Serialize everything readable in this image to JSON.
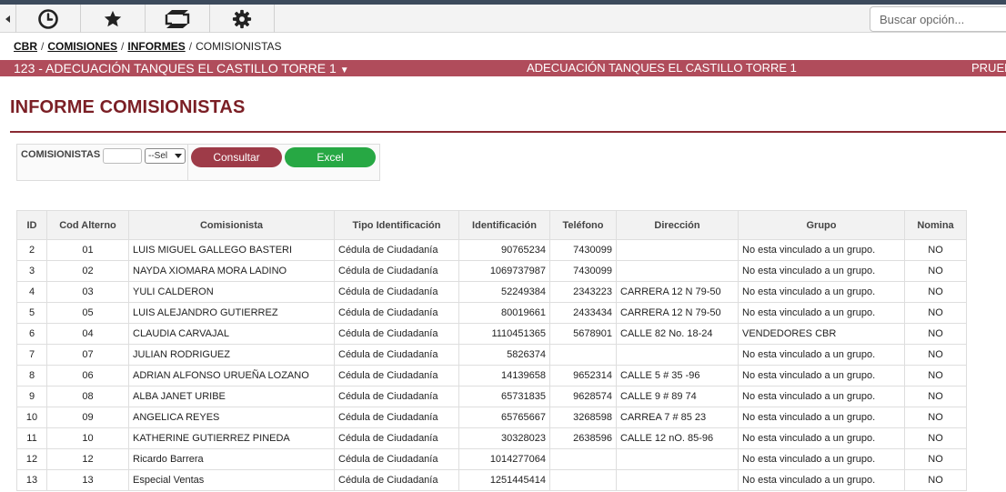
{
  "toolbar": {
    "icons": [
      "clock-icon",
      "star-icon",
      "exchange-icon",
      "gear-icon"
    ],
    "search_placeholder": "Buscar opción..."
  },
  "breadcrumb": {
    "items": [
      "CBR",
      "COMISIONES",
      "INFORMES"
    ],
    "current": "COMISIONISTAS"
  },
  "project_bar": {
    "selected": "123 - ADECUACIÓN TANQUES EL CASTILLO TORRE 1",
    "center_text": "ADECUACIÓN TANQUES EL CASTILLO TORRE 1",
    "right_text": "PRUEB",
    "color": "#b04c5b"
  },
  "page_title": "INFORME COMISIONISTAS",
  "filter": {
    "label": "COMISIONISTAS",
    "input_value": "",
    "select_value": "--Sel",
    "consultar_label": "Consultar",
    "excel_label": "Excel"
  },
  "table": {
    "headers": [
      "ID",
      "Cod Alterno",
      "Comisionista",
      "Tipo Identificación",
      "Identificación",
      "Teléfono",
      "Dirección",
      "Grupo",
      "Nomina"
    ],
    "rows": [
      [
        "2",
        "01",
        "LUIS MIGUEL GALLEGO BASTERI",
        "Cédula de Ciudadanía",
        "90765234",
        "7430099",
        "",
        "No esta vinculado a un grupo.",
        "NO"
      ],
      [
        "3",
        "02",
        "NAYDA XIOMARA MORA LADINO",
        "Cédula de Ciudadanía",
        "1069737987",
        "7430099",
        "",
        "No esta vinculado a un grupo.",
        "NO"
      ],
      [
        "4",
        "03",
        "YULI CALDERON",
        "Cédula de Ciudadanía",
        "52249384",
        "2343223",
        "CARRERA 12 N 79-50",
        "No esta vinculado a un grupo.",
        "NO"
      ],
      [
        "5",
        "05",
        "LUIS ALEJANDRO GUTIERREZ",
        "Cédula de Ciudadanía",
        "80019661",
        "2433434",
        "CARRERA 12 N 79-50",
        "No esta vinculado a un grupo.",
        "NO"
      ],
      [
        "6",
        "04",
        "CLAUDIA CARVAJAL",
        "Cédula de Ciudadanía",
        "1110451365",
        "5678901",
        "CALLE 82 No. 18-24",
        "VENDEDORES CBR",
        "NO"
      ],
      [
        "7",
        "07",
        "JULIAN RODRIGUEZ",
        "Cédula de Ciudadanía",
        "5826374",
        "",
        "",
        "No esta vinculado a un grupo.",
        "NO"
      ],
      [
        "8",
        "06",
        "ADRIAN ALFONSO URUEÑA LOZANO",
        "Cédula de Ciudadanía",
        "14139658",
        "9652314",
        "CALLE 5 # 35 -96",
        "No esta vinculado a un grupo.",
        "NO"
      ],
      [
        "9",
        "08",
        "ALBA JANET URIBE",
        "Cédula de Ciudadanía",
        "65731835",
        "9628574",
        "CALLE 9 # 89 74",
        "No esta vinculado a un grupo.",
        "NO"
      ],
      [
        "10",
        "09",
        "ANGELICA REYES",
        "Cédula de Ciudadanía",
        "65765667",
        "3268598",
        "CARREA 7 # 85 23",
        "No esta vinculado a un grupo.",
        "NO"
      ],
      [
        "11",
        "10",
        "KATHERINE GUTIERREZ PINEDA",
        "Cédula de Ciudadanía",
        "30328023",
        "2638596",
        "CALLE 12 nO. 85-96",
        "No esta vinculado a un grupo.",
        "NO"
      ],
      [
        "12",
        "12",
        "Ricardo Barrera",
        "Cédula de Ciudadanía",
        "1014277064",
        "",
        "",
        "No esta vinculado a un grupo.",
        "NO"
      ],
      [
        "13",
        "13",
        "Especial Ventas",
        "Cédula de Ciudadanía",
        "1251445414",
        "",
        "",
        "No esta vinculado a un grupo.",
        "NO"
      ]
    ]
  }
}
